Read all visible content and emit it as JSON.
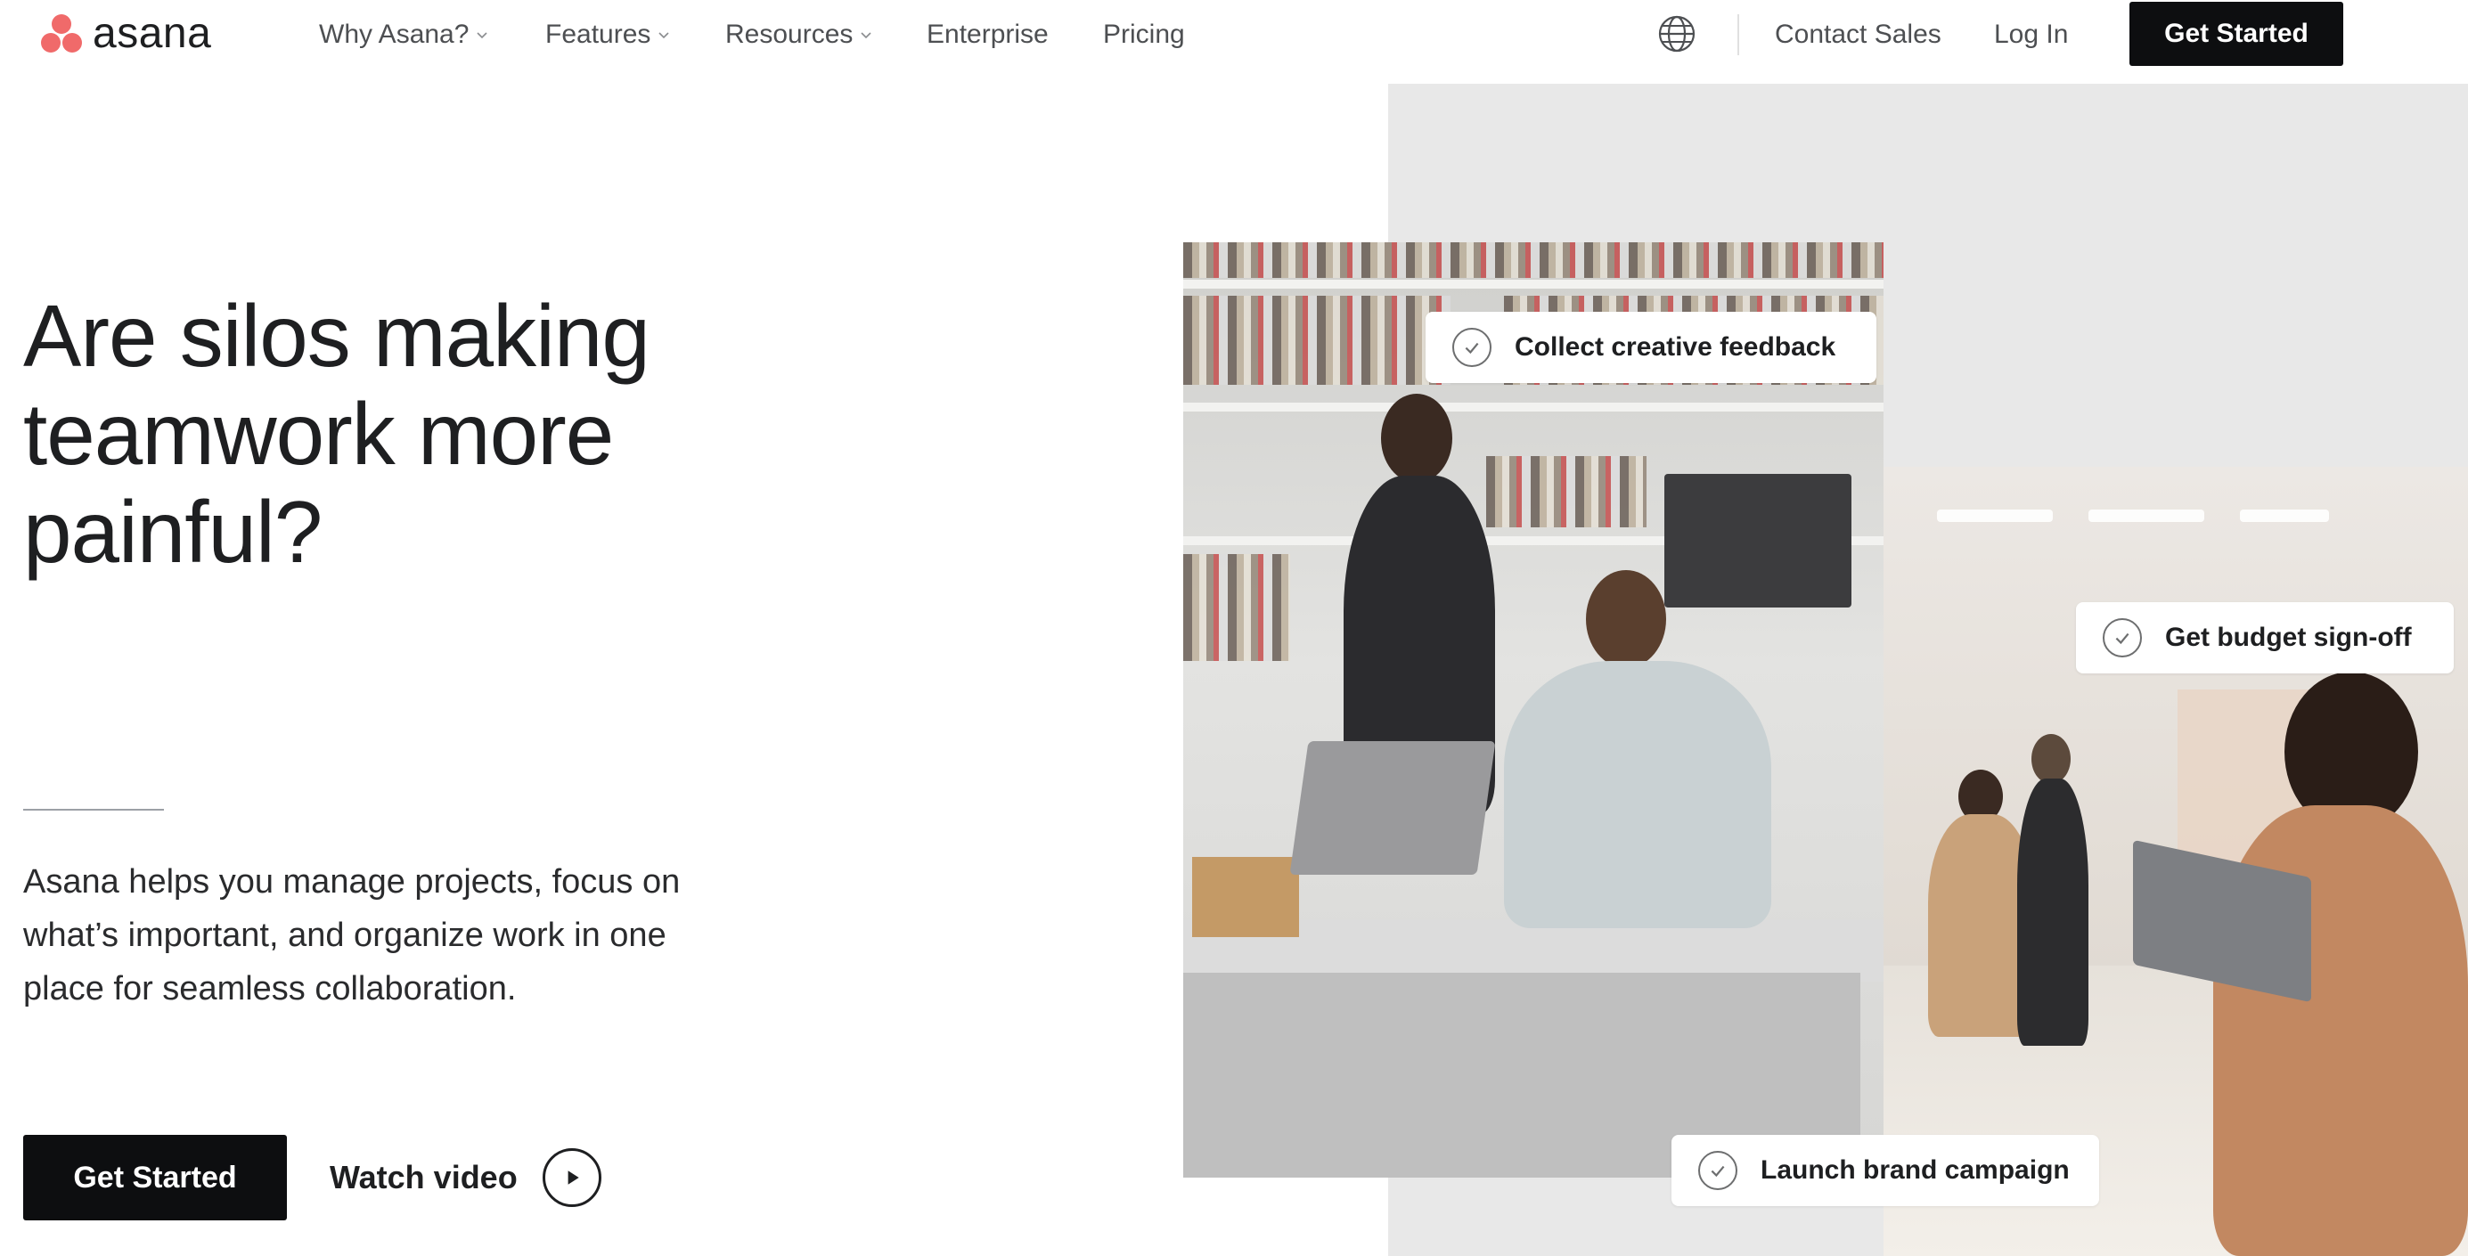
{
  "brand": {
    "name": "asana",
    "color": "#f06a6a"
  },
  "nav": {
    "items": [
      {
        "label": "Why Asana?",
        "has_dropdown": true
      },
      {
        "label": "Features",
        "has_dropdown": true
      },
      {
        "label": "Resources",
        "has_dropdown": true
      },
      {
        "label": "Enterprise",
        "has_dropdown": false
      },
      {
        "label": "Pricing",
        "has_dropdown": false
      }
    ],
    "contact_sales": "Contact Sales",
    "log_in": "Log In",
    "get_started": "Get Started",
    "globe_icon": "globe-icon"
  },
  "hero": {
    "headline_lines": [
      "Are silos making",
      "teamwork more",
      "painful?"
    ],
    "subtext_lines": [
      "Asana helps you manage projects, focus on",
      "what’s important, and organize work in one",
      "place for seamless collaboration."
    ],
    "cta_primary": "Get Started",
    "cta_secondary": "Watch video"
  },
  "tasks": [
    {
      "label": "Collect creative feedback"
    },
    {
      "label": "Get budget sign-off"
    },
    {
      "label": "Launch brand campaign"
    }
  ],
  "colors": {
    "accent": "#f06a6a",
    "button_dark": "#0d0e10",
    "panel_gray": "#e8e8e8",
    "text": "#1e1f21"
  }
}
